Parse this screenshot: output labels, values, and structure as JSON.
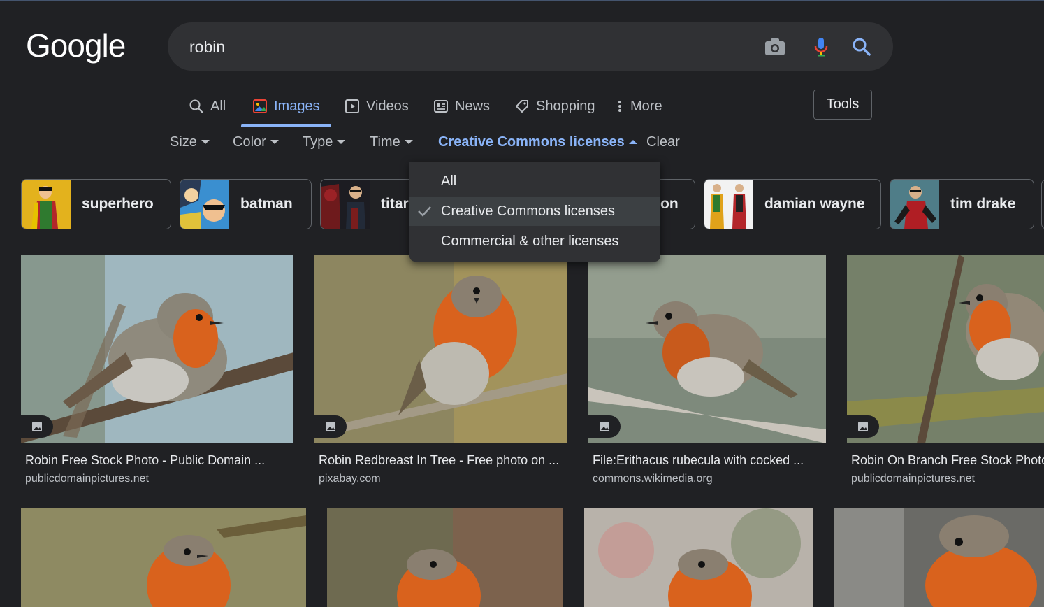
{
  "header": {
    "logo": "Google",
    "search_value": "robin"
  },
  "icons": {
    "camera": "camera-icon",
    "mic": "microphone-icon",
    "search": "search-icon"
  },
  "colors": {
    "accent": "#8ab4f8",
    "background": "#202124",
    "surface": "#303134",
    "bird_orange": "#d9621d"
  },
  "tabs": [
    {
      "label": "All",
      "icon": "search-icon"
    },
    {
      "label": "Images",
      "icon": "image-icon",
      "active": true
    },
    {
      "label": "Videos",
      "icon": "play-icon"
    },
    {
      "label": "News",
      "icon": "news-icon"
    },
    {
      "label": "Shopping",
      "icon": "tag-icon"
    },
    {
      "label": "More",
      "icon": "more-vert-icon"
    }
  ],
  "tools_label": "Tools",
  "filters": [
    {
      "label": "Size"
    },
    {
      "label": "Color"
    },
    {
      "label": "Type"
    },
    {
      "label": "Time"
    },
    {
      "label": "Creative Commons licenses",
      "active": true
    },
    {
      "label": "Clear"
    }
  ],
  "chips": [
    {
      "label": "superhero"
    },
    {
      "label": "batman"
    },
    {
      "label": "titar"
    },
    {
      "label": "on"
    },
    {
      "label": "damian wayne"
    },
    {
      "label": "tim drake"
    }
  ],
  "license_menu": {
    "items": [
      {
        "label": "All"
      },
      {
        "label": "Creative Commons licenses",
        "selected": true
      },
      {
        "label": "Commercial & other licenses"
      }
    ]
  },
  "results": [
    {
      "title": "Robin Free Stock Photo - Public Domain ...",
      "source": "publicdomainpictures.net"
    },
    {
      "title": "Robin Redbreast In Tree - Free photo on ...",
      "source": "pixabay.com"
    },
    {
      "title": "File:Erithacus rubecula with cocked ...",
      "source": "commons.wikimedia.org"
    },
    {
      "title": "Robin On Branch Free Stock Photo",
      "source": "publicdomainpictures.net"
    }
  ]
}
